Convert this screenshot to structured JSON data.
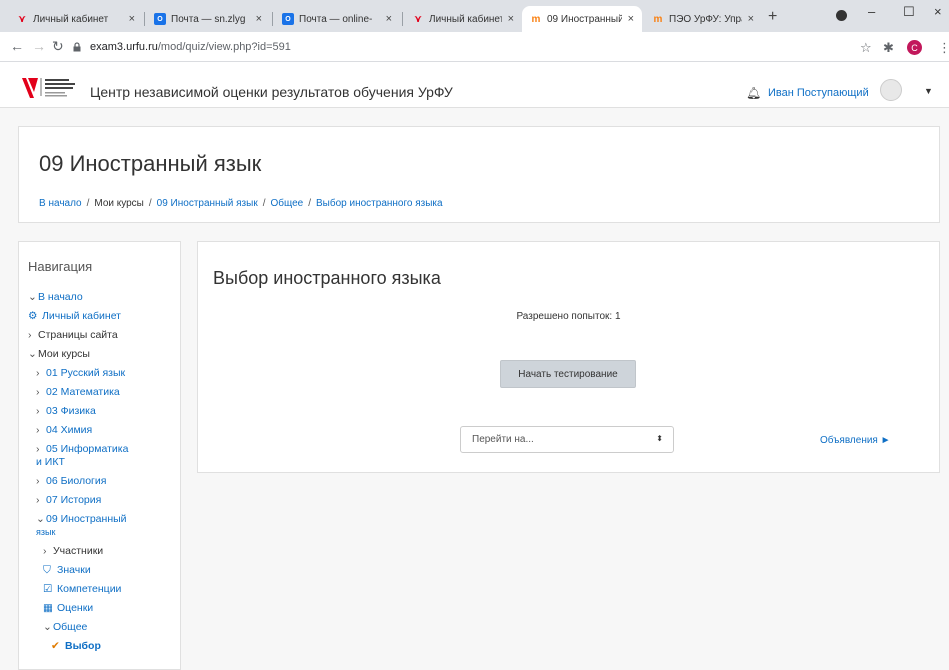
{
  "browser": {
    "tabs": [
      {
        "title": "Личный кабинет",
        "active": false
      },
      {
        "title": "Почта — sn.zlyg",
        "active": false
      },
      {
        "title": "Почта — online-",
        "active": false
      },
      {
        "title": "Личный кабинет",
        "active": false
      },
      {
        "title": "09 Иностранный",
        "active": true
      },
      {
        "title": "ПЭО УрФУ: Упра",
        "active": false
      }
    ],
    "new_tab": "+",
    "url_host": "exam3.urfu.ru",
    "url_path": "/mod/quiz/view.php?id=591",
    "profile_initial": "С"
  },
  "site": {
    "logo_text": "Уральский федеральный университет",
    "title": "Центр независимой оценки результатов обучения УрФУ",
    "user_name": "Иван Поступающий"
  },
  "header": {
    "course_title": "09 Иностранный язык",
    "breadcrumb": [
      "В начало",
      "Мои курсы",
      "09 Иностранный язык",
      "Общее",
      "Выбор иностранного языка"
    ]
  },
  "navigation": {
    "heading": "Навигация",
    "items": [
      {
        "label": "В начало",
        "marker": "⌄"
      },
      {
        "label": "Личный кабинет",
        "marker": ""
      },
      {
        "label": "Страницы сайта",
        "marker": "›"
      },
      {
        "label": "Мои курсы",
        "marker": "⌄"
      },
      {
        "label": "01 Русский язык",
        "marker": "›"
      },
      {
        "label": "02 Математика",
        "marker": "›"
      },
      {
        "label": "03 Физика",
        "marker": "›"
      },
      {
        "label": "04 Химия",
        "marker": "›"
      },
      {
        "label": "05 Информатика",
        "marker": "›"
      },
      {
        "label": "и ИКТ",
        "marker": ""
      },
      {
        "label": "06 Биология",
        "marker": "›"
      },
      {
        "label": "07 История",
        "marker": "›"
      },
      {
        "label": "09 Иностранный",
        "marker": "⌄"
      },
      {
        "label": "язык",
        "marker": ""
      },
      {
        "label": "Участники",
        "marker": "›"
      },
      {
        "label": "Значки",
        "marker": ""
      },
      {
        "label": "Компетенции",
        "marker": ""
      },
      {
        "label": "Оценки",
        "marker": ""
      },
      {
        "label": "Общее",
        "marker": "⌄"
      },
      {
        "label": "Выбор",
        "marker": ""
      }
    ]
  },
  "main": {
    "quiz_title": "Выбор иностранного языка",
    "attempts_text": "Разрешено попыток: 1",
    "start_button": "Начать тестирование",
    "jump_placeholder": "Перейти на...",
    "next_link": "Объявления ►"
  },
  "colors": {
    "link": "#0f6fc5",
    "button": "#ced4da",
    "brand_red": "#e2001a"
  }
}
